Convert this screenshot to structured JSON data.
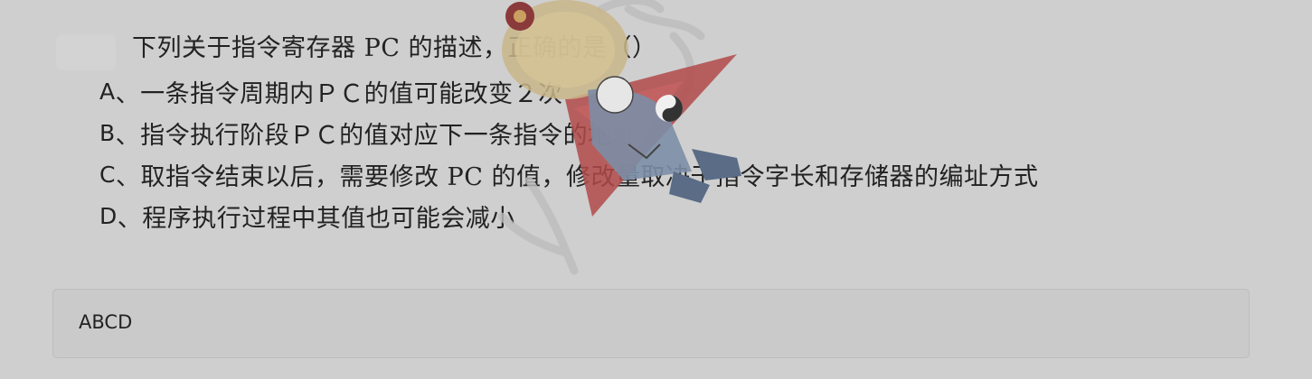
{
  "question": {
    "text": "下列关于指令寄存器 PC 的描述，正确的是（）"
  },
  "options": [
    {
      "letter": "A",
      "text": "、一条指令周期内ＰＣ的值可能改变２次"
    },
    {
      "letter": "B",
      "text": "、指令执行阶段ＰＣ的值对应下一条指令的地址"
    },
    {
      "letter": "C",
      "text": "、取指令结束以后，需要修改 PC 的值，修改量取决于指令字长和存储器的编址方式"
    },
    {
      "letter": "D",
      "text": "、程序执行过程中其值也可能会减小"
    }
  ],
  "answer": {
    "value": "ABCD"
  },
  "colors": {
    "background": "#cfcfcf",
    "text": "#222222",
    "answer_box": "#cacaca"
  },
  "icons": {
    "watermark": "mascot-watermark-icon"
  }
}
